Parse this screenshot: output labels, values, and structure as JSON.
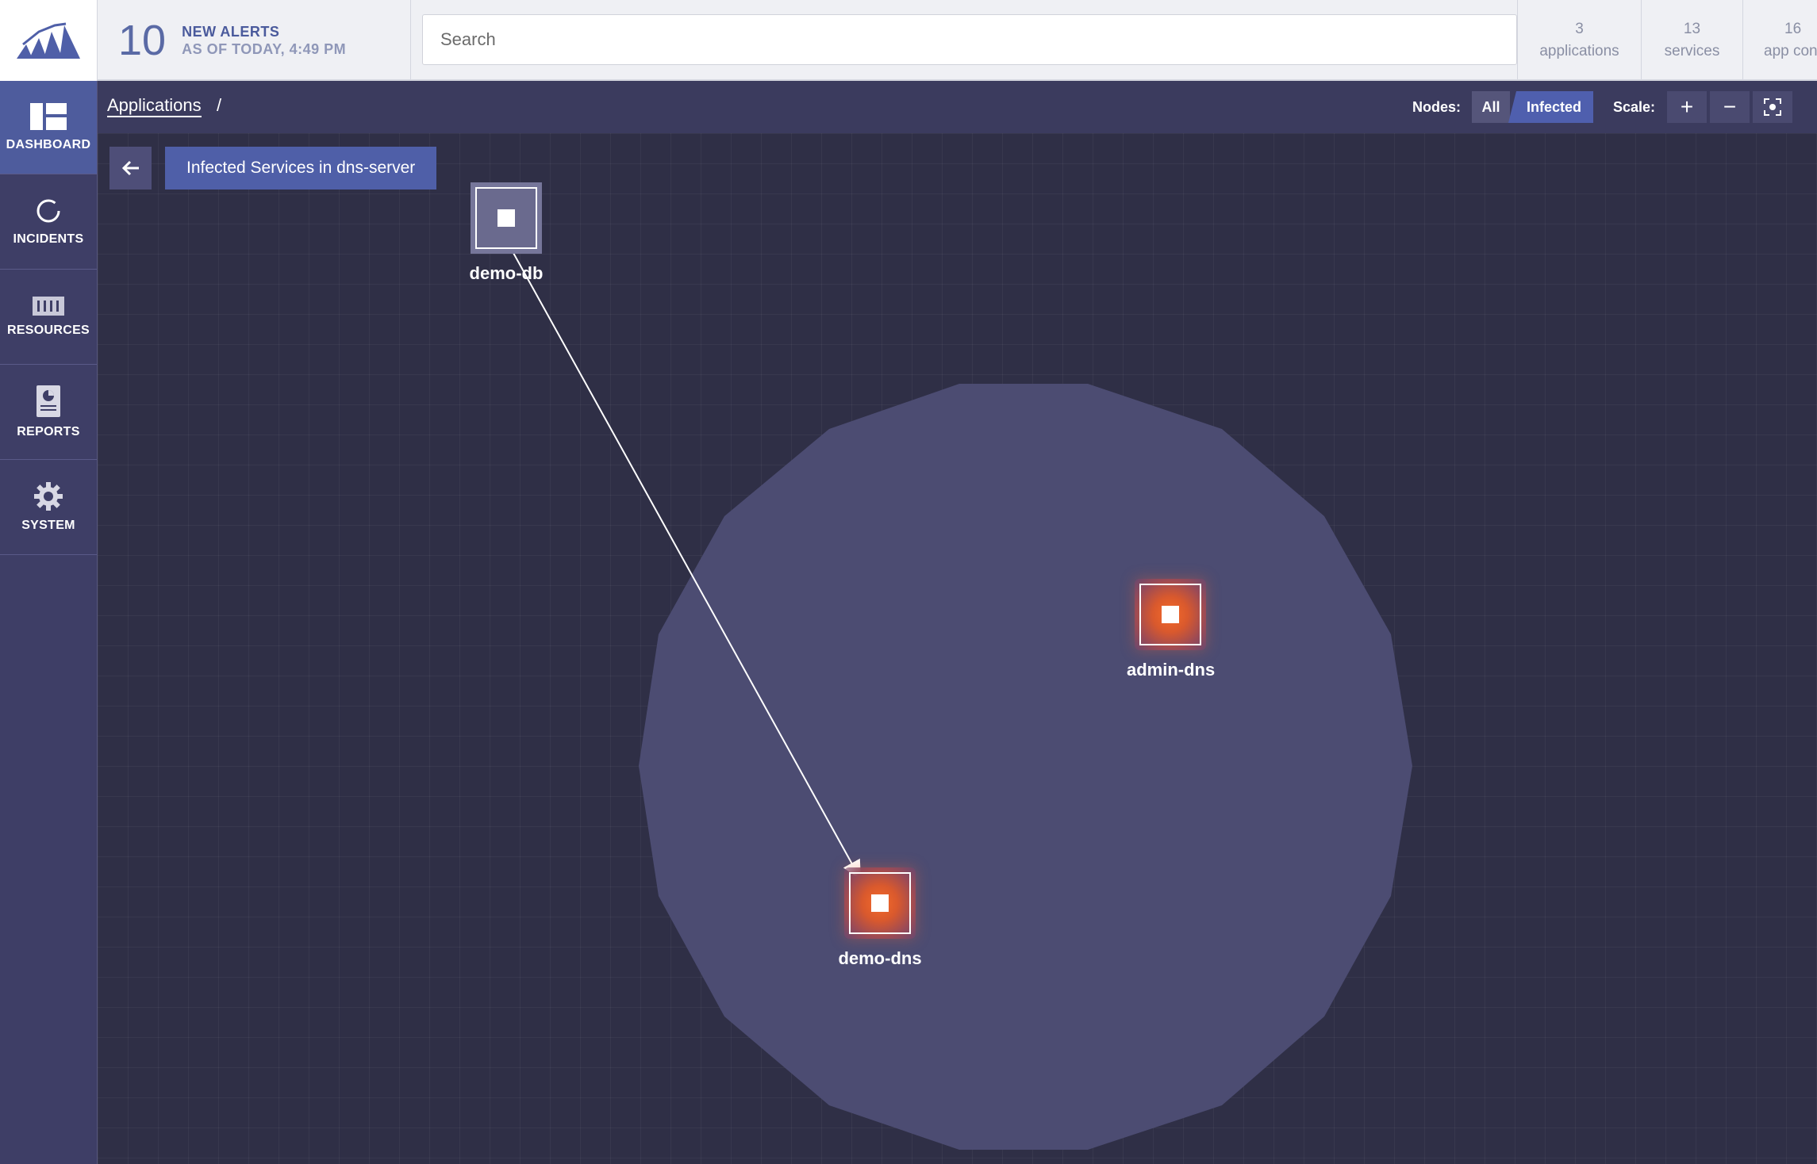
{
  "header": {
    "alerts_count": "10",
    "alerts_label": "NEW ALERTS",
    "alerts_sub": "AS OF TODAY, 4:49 PM",
    "search_placeholder": "Search",
    "stats": [
      {
        "value": "3",
        "label": "applications"
      },
      {
        "value": "13",
        "label": "services"
      },
      {
        "value": "16",
        "label": "app con"
      }
    ]
  },
  "sidebar": {
    "items": [
      {
        "label": "DASHBOARD",
        "icon": "dashboard-icon",
        "active": true
      },
      {
        "label": "INCIDENTS",
        "icon": "incidents-icon",
        "active": false
      },
      {
        "label": "RESOURCES",
        "icon": "resources-icon",
        "active": false
      },
      {
        "label": "REPORTS",
        "icon": "reports-icon",
        "active": false
      },
      {
        "label": "SYSTEM",
        "icon": "gear-icon",
        "active": false
      }
    ]
  },
  "toolbar": {
    "breadcrumb_root": "Applications",
    "breadcrumb_sep": "/",
    "nodes_label": "Nodes:",
    "nodes_all": "All",
    "nodes_infected": "Infected",
    "scale_label": "Scale:",
    "zoom_in": "+",
    "zoom_out": "−"
  },
  "graph": {
    "title": "Infected Services in dns-server",
    "nodes": [
      {
        "name": "demo-db",
        "state": "normal"
      },
      {
        "name": "admin-dns",
        "state": "infected"
      },
      {
        "name": "demo-dns",
        "state": "infected"
      }
    ],
    "edges": [
      {
        "from": "demo-db",
        "to": "demo-dns"
      }
    ]
  },
  "colors": {
    "accent": "#4f5fa8",
    "sidebar_bg": "#3e3e66",
    "canvas_bg": "#2f2f46",
    "infected": "#f56b2a"
  }
}
